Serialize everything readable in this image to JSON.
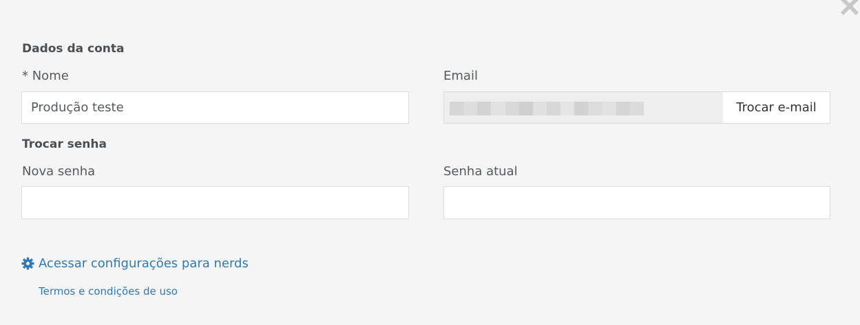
{
  "account_section": {
    "title": "Dados da conta",
    "name_label": "* Nome",
    "name_value": "Produção teste",
    "email_label": "Email",
    "email_value": "",
    "change_email_button": "Trocar e-mail"
  },
  "password_section": {
    "title": "Trocar senha",
    "new_password_label": "Nova senha",
    "current_password_label": "Senha atual"
  },
  "links": {
    "nerds_settings": "Acessar configurações para nerds",
    "terms": "Termos e condições de uso"
  },
  "icons": {
    "close": "close-icon",
    "settings": "gear-icon"
  },
  "colors": {
    "background": "#f5f5f5",
    "link": "#2f79b5",
    "label": "#555a5e",
    "title": "#4a4f54"
  }
}
